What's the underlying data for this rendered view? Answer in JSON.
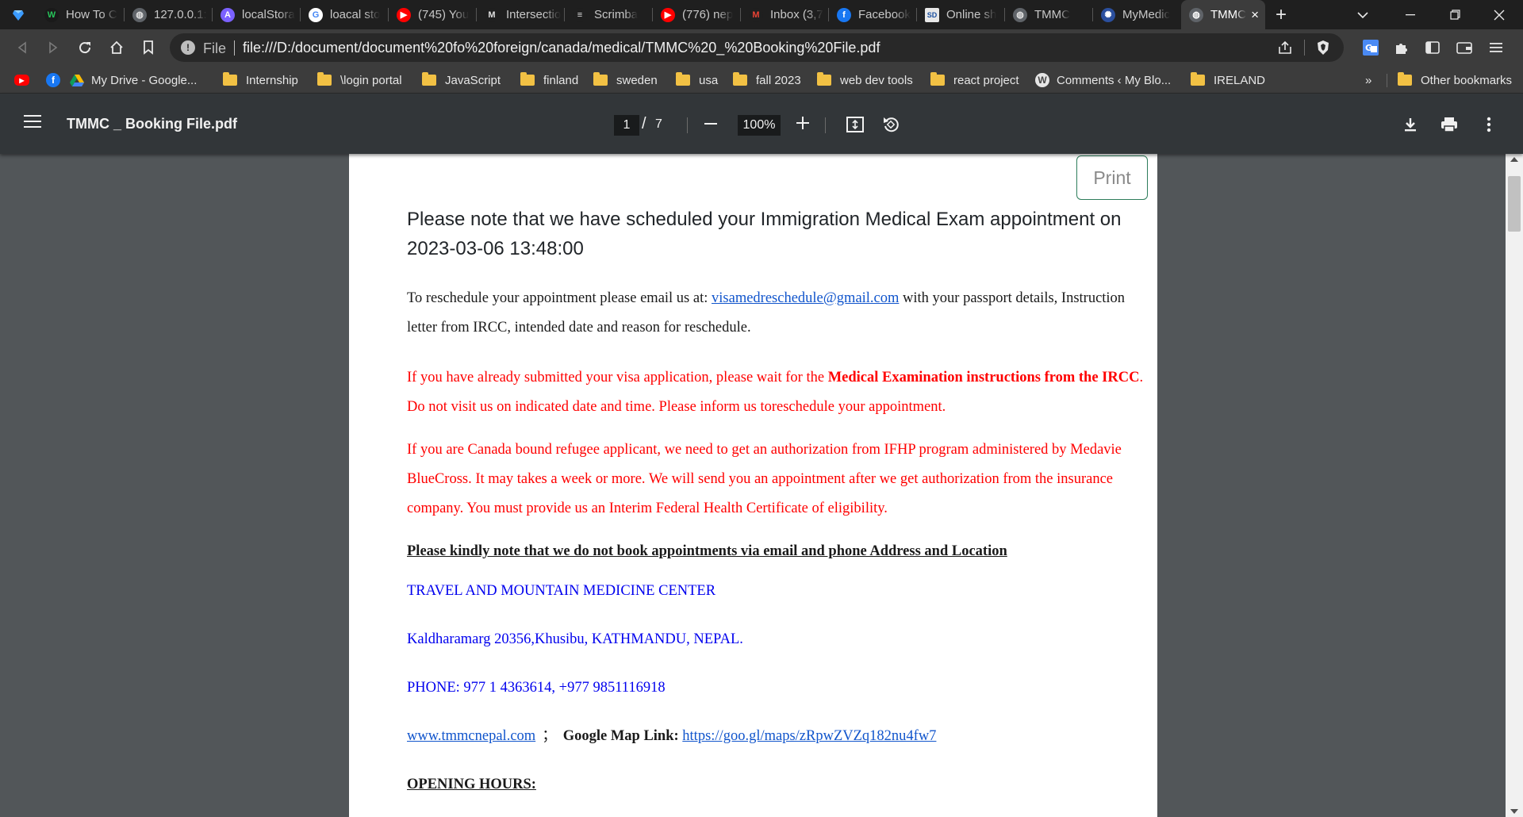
{
  "browser": {
    "tabs": [
      {
        "title": "How To C",
        "icon": "w-icon",
        "color": "#1a1a1a",
        "glyph": "W",
        "fg": "#27c45a"
      },
      {
        "title": "127.0.0.1:",
        "icon": "globe-icon",
        "color": "#5f6368",
        "glyph": "◍",
        "fg": "#e0e0e0"
      },
      {
        "title": "localStora",
        "icon": "localstorage-icon",
        "color": "#7b61ff",
        "glyph": "A",
        "fg": "#ffffff"
      },
      {
        "title": "loacal sto",
        "icon": "google-icon",
        "color": "#ffffff",
        "glyph": "G",
        "fg": "#4285f4"
      },
      {
        "title": "(745) You",
        "icon": "youtube-icon",
        "color": "#ff0000",
        "glyph": "▶",
        "fg": "#ffffff"
      },
      {
        "title": "Intersectio",
        "icon": "medium-icon",
        "color": "#1f1f1f",
        "glyph": "M",
        "fg": "#e0e0e0"
      },
      {
        "title": "Scrimba",
        "icon": "scrimba-icon",
        "color": "#1f1f1f",
        "glyph": "≡",
        "fg": "#e0e0e0"
      },
      {
        "title": "(776) nep",
        "icon": "youtube-icon",
        "color": "#ff0000",
        "glyph": "▶",
        "fg": "#ffffff"
      },
      {
        "title": "Inbox (3,7",
        "icon": "gmail-icon",
        "color": "#1f1f1f",
        "glyph": "M",
        "fg": "#ea4335"
      },
      {
        "title": "Facebook",
        "icon": "facebook-icon",
        "color": "#1877f2",
        "glyph": "f",
        "fg": "#ffffff"
      },
      {
        "title": "Online sh",
        "icon": "sd-icon",
        "color": "#e8e8e8",
        "glyph": "SD",
        "fg": "#1a4fa0"
      },
      {
        "title": "TMMC",
        "icon": "globe-icon",
        "color": "#5f6368",
        "glyph": "◍",
        "fg": "#e0e0e0"
      },
      {
        "title": "MyMedic",
        "icon": "mymedical-icon",
        "color": "#2b4f9e",
        "glyph": "✺",
        "fg": "#ffffff"
      }
    ],
    "active_tab": {
      "title": "TMMC",
      "close": "×"
    },
    "new_tab": "+",
    "address": {
      "scheme_label": "File",
      "url": "file:///D:/document/document%20fo%20foreign/canada/medical/TMMC%20_%20Booking%20File.pdf"
    },
    "bookmarks": [
      {
        "label": "My Drive - Google...",
        "type": "drive"
      },
      {
        "label": "Internship",
        "type": "folder"
      },
      {
        "label": "\\login portal",
        "type": "folder"
      },
      {
        "label": "JavaScript",
        "type": "folder"
      },
      {
        "label": "finland",
        "type": "folder"
      },
      {
        "label": "sweden",
        "type": "folder"
      },
      {
        "label": "usa",
        "type": "folder"
      },
      {
        "label": "fall 2023",
        "type": "folder"
      },
      {
        "label": "web dev tools",
        "type": "folder"
      },
      {
        "label": "react project",
        "type": "folder"
      },
      {
        "label": "Comments ‹ My Blo...",
        "type": "wordpress"
      },
      {
        "label": "IRELAND",
        "type": "folder"
      }
    ],
    "bookmarks_overflow": "»",
    "other_bookmarks": "Other bookmarks"
  },
  "pdf_viewer": {
    "title": "TMMC _ Booking File.pdf",
    "current_page": "1",
    "page_separator": "/",
    "total_pages": "7",
    "zoom": "100%"
  },
  "document": {
    "print_label": "Print",
    "heading": "Please note that we have scheduled your Immigration Medical Exam appointment on 2023-03-06 13:48:00",
    "reschedule": {
      "before": "To reschedule your appointment please email us at: ",
      "email": "visamedreschedule@gmail.com",
      "after": " with your passport details, Instruction letter from IRCC, intended date and reason for  reschedule."
    },
    "visa_notice": {
      "before": "If you have already submitted your visa application, please wait for the ",
      "bold": "Medical Examination instructions from the IRCC",
      "after": ". Do not visit us on indicated date and time. Please inform us toreschedule your appointment."
    },
    "refugee_notice": "If you are Canada bound refugee applicant, we need to get an authorization from IFHP program administered by Medavie BlueCross. It may takes a week or more. We will send you an appointment after we get authorization from the insurance company. You  must  provide us an  Interim  Federal Health Certificate of eligibility.",
    "booking_note": "Please kindly note that we do not book appointments via email and phone Address  and  Location",
    "center_name": "TRAVEL AND MOUNTAIN MEDICINE CENTER",
    "address": "Kaldharamarg 20356,Khusibu, KATHMANDU, NEPAL.",
    "phone": "PHONE: 977 1 4363614, +977 9851116918",
    "website": "www.tmmcnepal.com",
    "link_separator": "；",
    "map_label": "Google Map Link:",
    "map_url": "https://goo.gl/maps/zRpwZVZq182nu4fw7",
    "opening_hours": "OPENING HOURS:"
  }
}
